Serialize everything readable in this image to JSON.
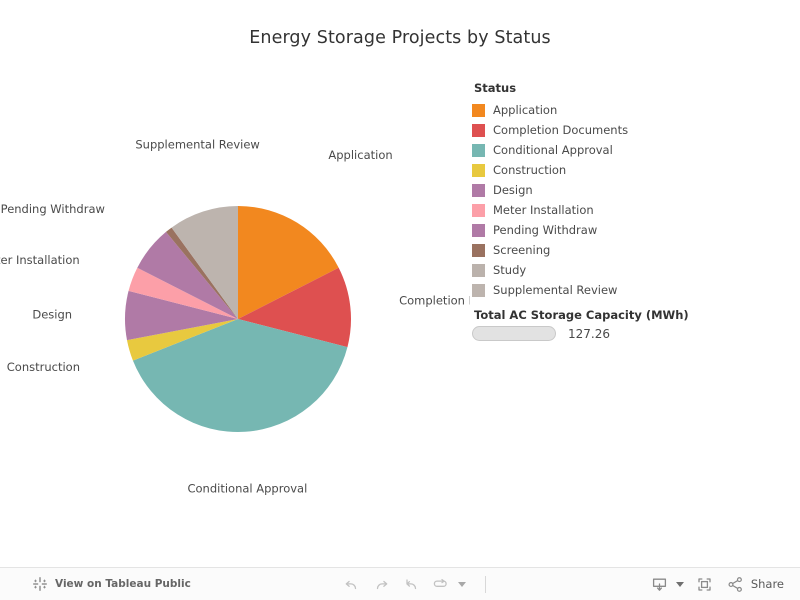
{
  "header": {
    "title": "Energy Storage Projects by Status"
  },
  "legend": {
    "title": "Status",
    "items": [
      {
        "label": "Application",
        "color": "#F2881F"
      },
      {
        "label": "Completion Documents",
        "color": "#DE5050"
      },
      {
        "label": "Conditional Approval",
        "color": "#76B7B2"
      },
      {
        "label": "Construction",
        "color": "#E8C93F"
      },
      {
        "label": "Design",
        "color": "#B07AA6"
      },
      {
        "label": "Meter Installation",
        "color": "#FC9FA8"
      },
      {
        "label": "Pending Withdraw",
        "color": "#B07AA6"
      },
      {
        "label": "Screening",
        "color": "#9A7260"
      },
      {
        "label": "Study",
        "color": "#BBB2AC"
      },
      {
        "label": "Supplemental Review",
        "color": "#BDB4AE"
      }
    ]
  },
  "filter": {
    "title": "Total AC Storage Capacity (MWh)",
    "value": "127.26"
  },
  "toolbar": {
    "brand_label": "View on Tableau Public",
    "tableau_logo_icon": "tableau-logo-icon",
    "undo_icon": "undo-icon",
    "redo_icon": "redo-icon",
    "revert_icon": "revert-icon",
    "refresh_icon": "refresh-icon",
    "refresh_caret_icon": "chevron-down-icon",
    "download_icon": "download-icon",
    "download_caret_icon": "chevron-down-icon",
    "fullscreen_icon": "fullscreen-icon",
    "share_icon": "share-icon",
    "share_label": "Share"
  },
  "chart_data": {
    "type": "pie",
    "title": "Energy Storage Projects by Status",
    "legend_title": "Status",
    "legend_position": "right",
    "value_unit": "share of projects (%)",
    "categories": [
      "Application",
      "Completion Documents",
      "Conditional Approval",
      "Construction",
      "Design",
      "Meter Installation",
      "Pending Withdraw",
      "Screening",
      "Study",
      "Supplemental Review"
    ],
    "values": [
      17.5,
      11.5,
      40.0,
      3.0,
      7.0,
      3.5,
      6.5,
      1.0,
      0.0,
      10.0
    ],
    "colors": [
      "#F2881F",
      "#DE5050",
      "#76B7B2",
      "#E8C93F",
      "#B07AA6",
      "#FC9FA8",
      "#B07AA6",
      "#9A7260",
      "#BBB2AC",
      "#BDB4AE"
    ],
    "slice_order_clockwise_from_top": [
      "Application",
      "Completion Documents",
      "Conditional Approval",
      "Construction",
      "Design",
      "Meter Installation",
      "Pending Withdraw",
      "Screening",
      "Supplemental Review"
    ],
    "labels_shown": [
      "Application",
      "Completion Documents",
      "Conditional Approval",
      "Construction",
      "Design",
      "Meter Installation",
      "Pending Withdraw",
      "Supplemental Review"
    ],
    "annotations": []
  }
}
